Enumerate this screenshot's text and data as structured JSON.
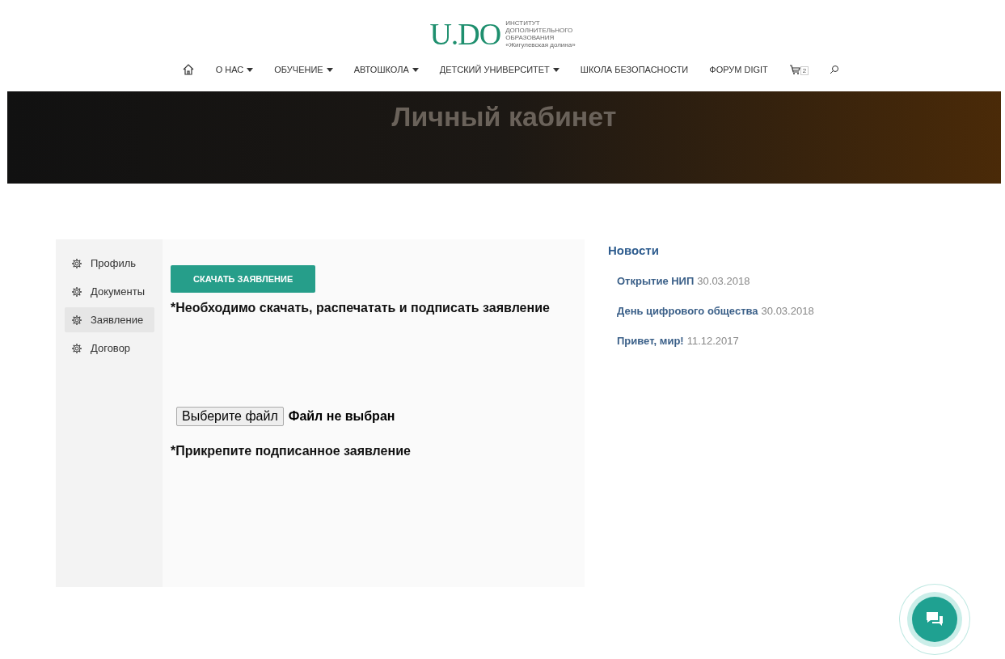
{
  "logo": {
    "mark": "U.DO",
    "lines": [
      "ИНСТИТУТ",
      "ДОПОЛНИТЕЛЬНОГО",
      "ОБРАЗОВАНИЯ",
      "«Жигулевская долина»"
    ]
  },
  "nav": [
    {
      "label": "О НАС",
      "dropdown": true
    },
    {
      "label": "ОБУЧЕНИЕ",
      "dropdown": true
    },
    {
      "label": "АВТОШКОЛА",
      "dropdown": true
    },
    {
      "label": "ДЕТСКИЙ УНИВЕРСИТЕТ",
      "dropdown": true
    },
    {
      "label": "ШКОЛА БЕЗОПАСНОСТИ",
      "dropdown": false
    },
    {
      "label": "ФОРУМ DIGIT",
      "dropdown": false
    }
  ],
  "cart_count": "2",
  "hero": {
    "title": "Личный кабинет"
  },
  "sidebar": {
    "items": [
      {
        "label": "Профиль",
        "selected": false
      },
      {
        "label": "Документы",
        "selected": false
      },
      {
        "label": "Заявление",
        "selected": true
      },
      {
        "label": "Договор",
        "selected": false
      }
    ]
  },
  "main": {
    "download_button": "СКАЧАТЬ ЗАЯВЛЕНИЕ",
    "download_note": "*Необходимо скачать, распечатать и подписать заявление",
    "file_button": "Выберите файл",
    "file_status": "Файл не выбран",
    "attach_note": "*Прикрепите подписанное заявление"
  },
  "news": {
    "title": "Новости",
    "items": [
      {
        "title": "Открытие НИП",
        "date": "30.03.2018"
      },
      {
        "title": "День цифрового общества",
        "date": "30.03.2018"
      },
      {
        "title": "Привет, мир!",
        "date": "11.12.2017"
      }
    ]
  }
}
